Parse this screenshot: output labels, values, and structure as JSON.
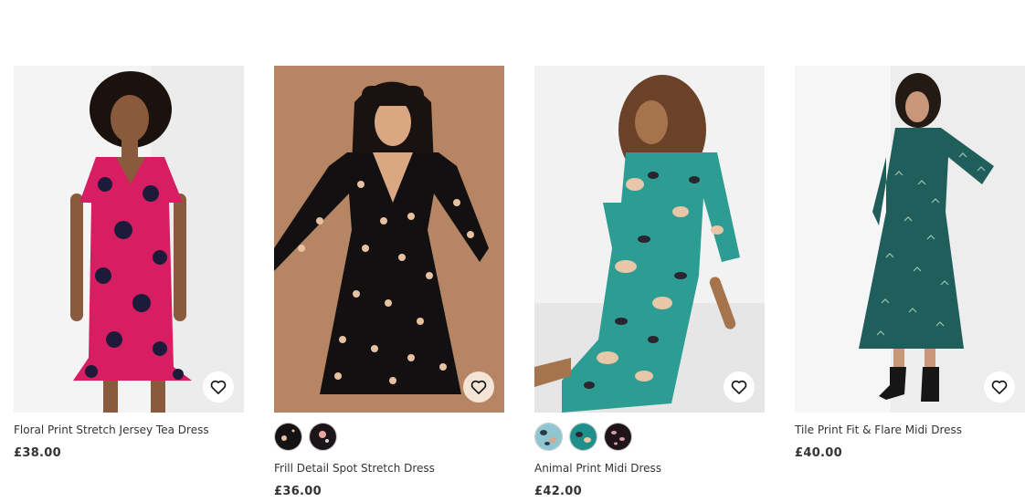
{
  "products": [
    {
      "title": "Floral Print Stretch Jersey Tea Dress",
      "price": "£38.00",
      "image_alt": "Model in pink floral tea dress",
      "wishlist_icon": "heart-icon",
      "swatches": []
    },
    {
      "title": "Frill Detail Spot Stretch Dress",
      "price": "£36.00",
      "image_alt": "Model in black polka dot dress",
      "wishlist_icon": "heart-icon",
      "swatches": [
        "black-spot",
        "black-floral"
      ]
    },
    {
      "title": "Animal Print Midi Dress",
      "price": "£42.00",
      "image_alt": "Model in teal animal print midi dress",
      "wishlist_icon": "heart-icon",
      "swatches": [
        "blue-animal",
        "teal-animal",
        "black-animal"
      ]
    },
    {
      "title": "Tile Print Fit & Flare Midi Dress",
      "price": "£40.00",
      "image_alt": "Model in teal tile print midi dress",
      "wishlist_icon": "heart-icon",
      "swatches": []
    }
  ],
  "colors": {
    "pink_dress": "#d81e62",
    "navy": "#1e1b3a",
    "spot_bg": "#b68563",
    "teal": "#1f8f8c",
    "tile_teal": "#1f5e5a"
  }
}
